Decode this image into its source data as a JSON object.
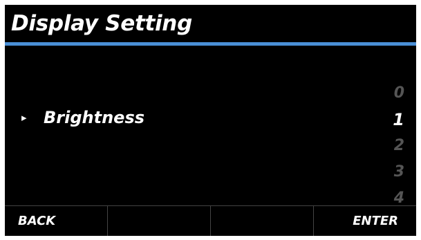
{
  "header": {
    "title": "Display Setting"
  },
  "menu": {
    "items": [
      {
        "label": "Brightness",
        "arrow": "▸",
        "selected": true
      }
    ]
  },
  "value_picker": {
    "options": [
      "0",
      "1",
      "2",
      "3",
      "4"
    ],
    "selected": "1"
  },
  "softkeys": {
    "key1": "BACK",
    "key2": "",
    "key3": "",
    "key4": "ENTER"
  },
  "colors": {
    "background": "#000000",
    "accent_rule": "#4a8fd6",
    "text": "#ffffff",
    "dimmed_value": "#555555",
    "divider": "#444444"
  }
}
